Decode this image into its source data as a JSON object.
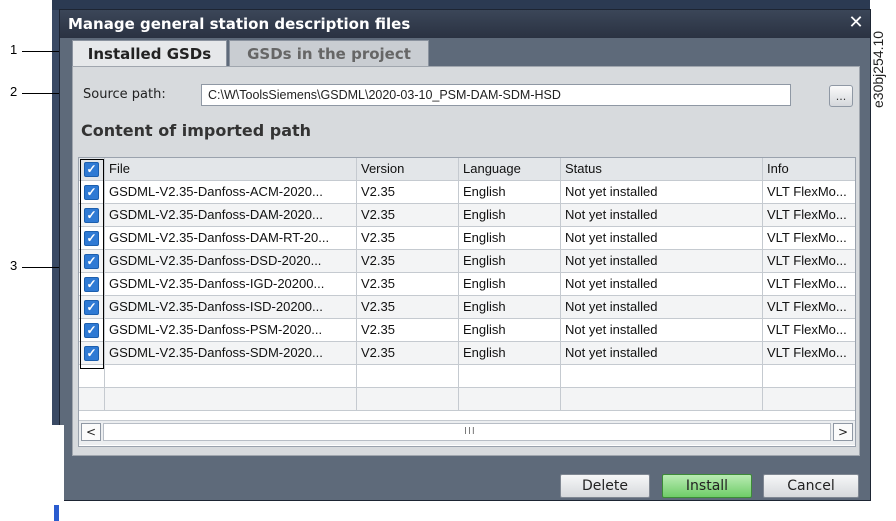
{
  "dialog": {
    "title": "Manage general station description files",
    "close_glyph": "✕",
    "tabs": [
      {
        "label": "Installed GSDs",
        "active": true
      },
      {
        "label": "GSDs in the project",
        "active": false
      }
    ],
    "source_path_label": "Source path:",
    "source_path_value": "C:\\W\\ToolsSiemens\\GSDML\\2020-03-10_PSM-DAM-SDM-HSD",
    "browse_label": "...",
    "section_title": "Content of imported path",
    "table": {
      "columns": [
        "File",
        "Version",
        "Language",
        "Status",
        "Info"
      ],
      "header_checked": true,
      "rows": [
        {
          "file": "GSDML-V2.35-Danfoss-ACM-2020...",
          "version": "V2.35",
          "language": "English",
          "status": "Not yet installed",
          "info": "VLT FlexMo...",
          "checked": true
        },
        {
          "file": "GSDML-V2.35-Danfoss-DAM-2020...",
          "version": "V2.35",
          "language": "English",
          "status": "Not yet installed",
          "info": "VLT FlexMo...",
          "checked": true
        },
        {
          "file": "GSDML-V2.35-Danfoss-DAM-RT-20...",
          "version": "V2.35",
          "language": "English",
          "status": "Not yet installed",
          "info": "VLT FlexMo...",
          "checked": true
        },
        {
          "file": "GSDML-V2.35-Danfoss-DSD-2020...",
          "version": "V2.35",
          "language": "English",
          "status": "Not yet installed",
          "info": "VLT FlexMo...",
          "checked": true
        },
        {
          "file": "GSDML-V2.35-Danfoss-IGD-20200...",
          "version": "V2.35",
          "language": "English",
          "status": "Not yet installed",
          "info": "VLT FlexMo...",
          "checked": true
        },
        {
          "file": "GSDML-V2.35-Danfoss-ISD-20200...",
          "version": "V2.35",
          "language": "English",
          "status": "Not yet installed",
          "info": "VLT FlexMo...",
          "checked": true
        },
        {
          "file": "GSDML-V2.35-Danfoss-PSM-2020...",
          "version": "V2.35",
          "language": "English",
          "status": "Not yet installed",
          "info": "VLT FlexMo...",
          "checked": true
        },
        {
          "file": "GSDML-V2.35-Danfoss-SDM-2020...",
          "version": "V2.35",
          "language": "English",
          "status": "Not yet installed",
          "info": "VLT FlexMo...",
          "checked": true
        }
      ]
    },
    "scroll": {
      "left": "<",
      "right": ">",
      "grip": "III"
    },
    "buttons": {
      "delete": "Delete",
      "install": "Install",
      "cancel": "Cancel"
    }
  },
  "callouts": {
    "one": "1",
    "two": "2",
    "three": "3"
  },
  "reference_code": "e30bj254.10",
  "colors": {
    "title_bar": "#2a3242",
    "checkbox": "#2f7ad4",
    "install_button": "#6fcc68",
    "dialog_bg": "#5e6a7a"
  }
}
